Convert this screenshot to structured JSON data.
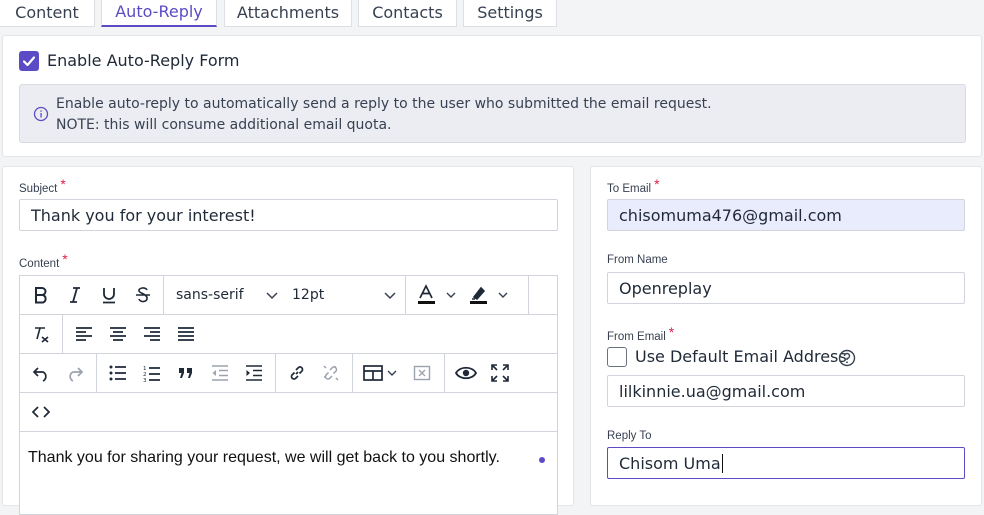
{
  "tabs": [
    {
      "label": "Content",
      "active": false
    },
    {
      "label": "Auto-Reply",
      "active": true
    },
    {
      "label": "Attachments",
      "active": false
    },
    {
      "label": "Contacts",
      "active": false
    },
    {
      "label": "Settings",
      "active": false
    }
  ],
  "enable": {
    "label": "Enable Auto-Reply Form",
    "checked": true,
    "info_line1": "Enable auto-reply to automatically send a reply to the user who submitted the email request.",
    "info_line2": "NOTE: this will consume additional email quota."
  },
  "form": {
    "subject_label": "Subject",
    "subject_value": "Thank you for your interest!",
    "content_label": "Content",
    "font_family": "sans-serif",
    "font_size": "12pt",
    "content_body": "Thank you for sharing your request, we will get back to you shortly.",
    "required_mark": "*"
  },
  "side": {
    "to_email_label": "To Email",
    "to_email_value": "chisomuma476@gmail.com",
    "from_name_label": "From Name",
    "from_name_value": "Openreplay",
    "from_email_label": "From Email",
    "use_default_label": "Use Default Email Address",
    "from_email_value": "lilkinnie.ua@gmail.com",
    "reply_to_label": "Reply To",
    "reply_to_value": "Chisom Uma"
  },
  "colors": {
    "accent": "#5b4bc4",
    "required": "#e11d48",
    "info_bg": "#ecedf3",
    "filled_input": "#e8ecfc"
  }
}
